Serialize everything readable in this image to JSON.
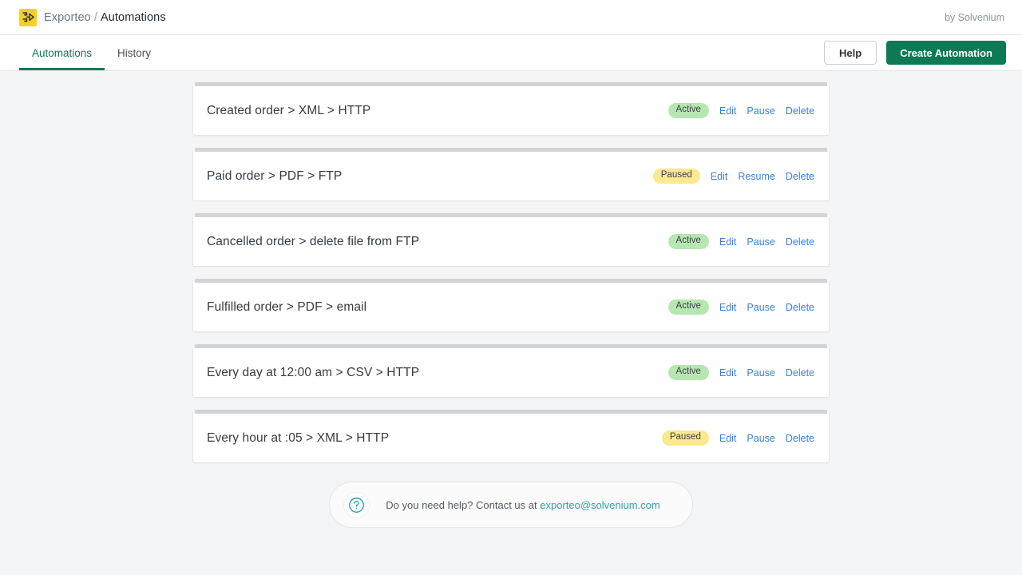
{
  "header": {
    "logo_icon": "exporteo-flow-logo-icon",
    "app_name": "Exporteo",
    "separator": "/",
    "section": "Automations",
    "byline": "by Solvenium"
  },
  "nav": {
    "tabs": [
      {
        "label": "Automations",
        "active": true
      },
      {
        "label": "History",
        "active": false
      }
    ],
    "help_label": "Help",
    "create_label": "Create Automation"
  },
  "automations": [
    {
      "title": "Created order > XML > HTTP",
      "status": "Active",
      "status_kind": "active",
      "edit": "Edit",
      "toggle": "Pause",
      "delete": "Delete"
    },
    {
      "title": "Paid order > PDF > FTP",
      "status": "Paused",
      "status_kind": "paused",
      "edit": "Edit",
      "toggle": "Resume",
      "delete": "Delete"
    },
    {
      "title": "Cancelled order > delete file from FTP",
      "status": "Active",
      "status_kind": "active",
      "edit": "Edit",
      "toggle": "Pause",
      "delete": "Delete"
    },
    {
      "title": "Fulfilled order > PDF > email",
      "status": "Active",
      "status_kind": "active",
      "edit": "Edit",
      "toggle": "Pause",
      "delete": "Delete"
    },
    {
      "title": "Every day at 12:00 am > CSV > HTTP",
      "status": "Active",
      "status_kind": "active",
      "edit": "Edit",
      "toggle": "Pause",
      "delete": "Delete"
    },
    {
      "title": "Every hour at :05 > XML > HTTP",
      "status": "Paused",
      "status_kind": "paused",
      "edit": "Edit",
      "toggle": "Pause",
      "delete": "Delete"
    }
  ],
  "help_footer": {
    "icon": "question-mark-circle-icon",
    "text": "Do you need help? Contact us at ",
    "email": "exporteo@solvenium.com"
  },
  "colors": {
    "brand_green": "#0d7a55",
    "logo_yellow": "#f5cf2b",
    "badge_active": "#b6e7b0",
    "badge_paused": "#fae98d",
    "link_blue": "#3c7fd4",
    "email_teal": "#2e9fb0",
    "page_bg": "#f4f5f7"
  }
}
